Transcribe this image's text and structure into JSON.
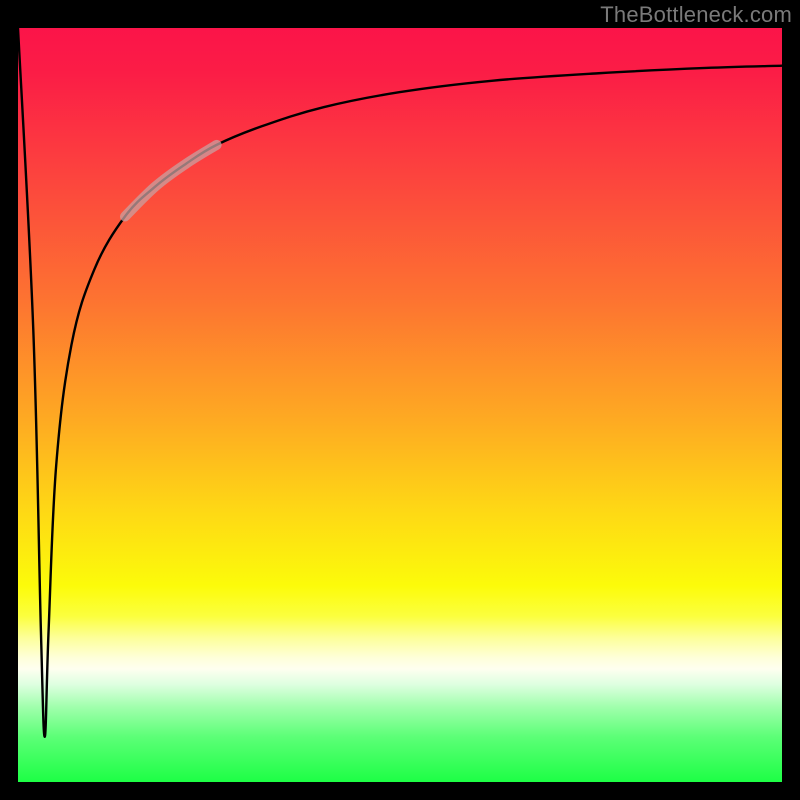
{
  "attribution": "TheBottleneck.com",
  "chart_data": {
    "type": "line",
    "title": "",
    "xlabel": "",
    "ylabel": "",
    "xlim": [
      0,
      100
    ],
    "ylim": [
      0,
      100
    ],
    "notes": "Bottleneck-percentage-style curve on a red→green vertical gradient background. A sharp negative spike near x≈3–4 drops close to y≈5, then a logarithmic-looking rise that asymptotes near y≈95. A short faded/highlighted segment sits on the rising curve around x≈18–25.",
    "series": [
      {
        "name": "curve",
        "x": [
          0,
          2,
          3,
          3.5,
          4,
          5,
          7,
          10,
          14,
          18,
          22,
          26,
          32,
          40,
          50,
          62,
          76,
          90,
          100
        ],
        "y": [
          100,
          60,
          20,
          6,
          20,
          42,
          58,
          68,
          75,
          79,
          82,
          84.5,
          87,
          89.5,
          91.5,
          93,
          94,
          94.7,
          95
        ]
      }
    ],
    "highlight_segment": {
      "x_start": 18,
      "x_end": 25
    },
    "gradient_stops": [
      {
        "pos": 0,
        "color": "#fb1449"
      },
      {
        "pos": 0.36,
        "color": "#fd7331"
      },
      {
        "pos": 0.64,
        "color": "#fed815"
      },
      {
        "pos": 0.83,
        "color": "#fefff0"
      },
      {
        "pos": 1.0,
        "color": "#1dff45"
      }
    ]
  }
}
